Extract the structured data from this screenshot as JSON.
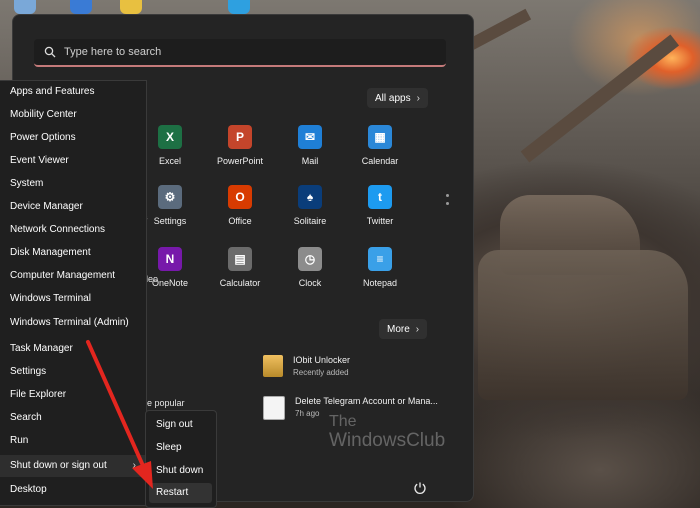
{
  "search": {
    "placeholder": "Type here to search"
  },
  "pinned": {
    "all_apps_label": "All apps",
    "apps": [
      {
        "label": "Excel",
        "icon": "excel-icon",
        "color": "#1d7044",
        "glyph": "X"
      },
      {
        "label": "PowerPoint",
        "icon": "powerpoint-icon",
        "color": "#c4452b",
        "glyph": "P"
      },
      {
        "label": "Mail",
        "icon": "mail-icon",
        "color": "#1f7fd6",
        "glyph": "✉"
      },
      {
        "label": "Calendar",
        "icon": "calendar-icon",
        "color": "#2b88d8",
        "glyph": "▦"
      },
      {
        "label": "Settings",
        "icon": "settings-icon",
        "color": "#5b6b7d",
        "glyph": "⚙"
      },
      {
        "label": "Office",
        "icon": "office-icon",
        "color": "#d83b01",
        "glyph": "O"
      },
      {
        "label": "Solitaire",
        "icon": "solitaire-icon",
        "color": "#0a3d7a",
        "glyph": "♠"
      },
      {
        "label": "Twitter",
        "icon": "twitter-icon",
        "color": "#1d9bf0",
        "glyph": "t"
      },
      {
        "label": "OneNote",
        "icon": "onenote-icon",
        "color": "#7719aa",
        "glyph": "N"
      },
      {
        "label": "Calculator",
        "icon": "calculator-icon",
        "color": "#6b6b6b",
        "glyph": "▤"
      },
      {
        "label": "Clock",
        "icon": "clock-icon",
        "color": "#8c8c8c",
        "glyph": "◷"
      },
      {
        "label": "Notepad",
        "icon": "notepad-icon",
        "color": "#3aa0e8",
        "glyph": "≡"
      }
    ],
    "partial_labels": [
      "s",
      "deo"
    ]
  },
  "recommended": {
    "more_label": "More",
    "partial_label": "e popular",
    "items": [
      {
        "title": "IObit Unlocker",
        "subtitle": "Recently added"
      },
      {
        "title": "Delete Telegram Account or Mana...",
        "subtitle": "7h ago"
      }
    ]
  },
  "winx_menu": {
    "items": [
      "Apps and Features",
      "Mobility Center",
      "Power Options",
      "Event Viewer",
      "System",
      "Device Manager",
      "Network Connections",
      "Disk Management",
      "Computer Management",
      "Windows Terminal",
      "Windows Terminal (Admin)",
      "Task Manager",
      "Settings",
      "File Explorer",
      "Search",
      "Run",
      "Shut down or sign out",
      "Desktop"
    ],
    "submenu_arrow": "›"
  },
  "shutdown_submenu": {
    "items": [
      "Sign out",
      "Sleep",
      "Shut down",
      "Restart"
    ]
  },
  "watermark": {
    "line1": "The",
    "line2": "WindowsClub"
  },
  "colors": {
    "accent_underline": "#c47a7a",
    "annotation_arrow": "#e3261f"
  }
}
